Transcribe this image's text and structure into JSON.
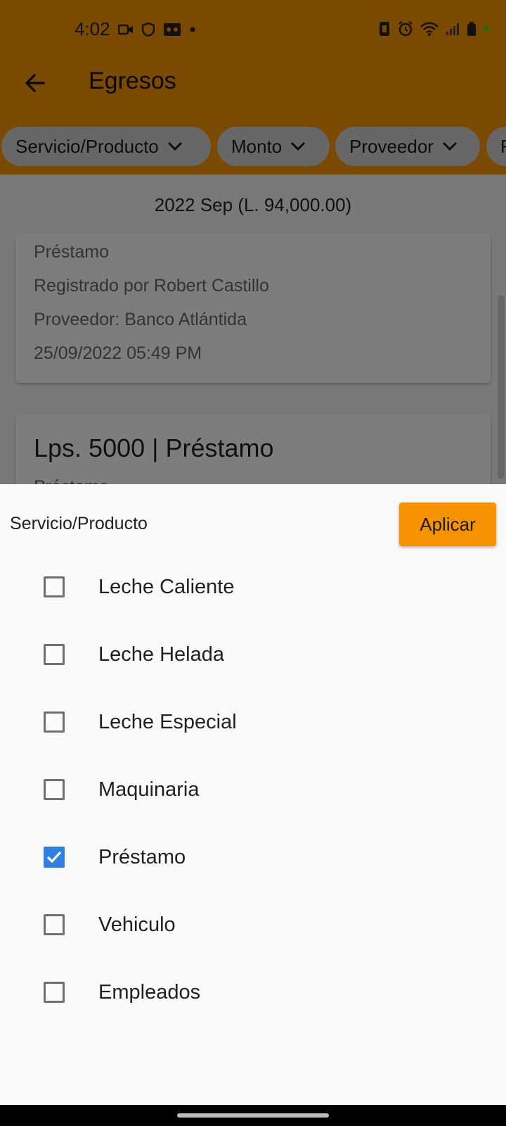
{
  "status_bar": {
    "time": "4:02",
    "left_icons": [
      "video-icon",
      "shield-icon",
      "voicemail-icon",
      "dot-icon"
    ],
    "right_icons": [
      "vibrate-icon",
      "alarm-icon",
      "wifi-icon",
      "signal-icon",
      "battery-icon"
    ]
  },
  "app_bar": {
    "title": "Egresos",
    "back_icon": "arrow-left-icon"
  },
  "filters": [
    {
      "label": "Servicio/Producto"
    },
    {
      "label": "Monto"
    },
    {
      "label": "Proveedor"
    },
    {
      "label": "F"
    }
  ],
  "list": {
    "month_header": "2022 Sep (L. 94,000.00)",
    "card1": {
      "lines": [
        "Préstamo",
        "Registrado por Robert Castillo",
        "Proveedor: Banco Atlántida",
        "25/09/2022 05:49 PM"
      ]
    },
    "card2": {
      "title": "Lps. 5000 | Préstamo",
      "partial_line": "Préstamo"
    }
  },
  "sheet": {
    "title": "Servicio/Producto",
    "apply_label": "Aplicar",
    "options": [
      {
        "label": "Leche Caliente",
        "checked": false
      },
      {
        "label": "Leche Helada",
        "checked": false
      },
      {
        "label": "Leche Especial",
        "checked": false
      },
      {
        "label": "Maquinaria",
        "checked": false
      },
      {
        "label": "Préstamo",
        "checked": true
      },
      {
        "label": "Vehiculo",
        "checked": false
      },
      {
        "label": "Empleados",
        "checked": false
      }
    ]
  },
  "colors": {
    "accent": "#f59400",
    "checkbox_checked": "#2f80e2"
  }
}
